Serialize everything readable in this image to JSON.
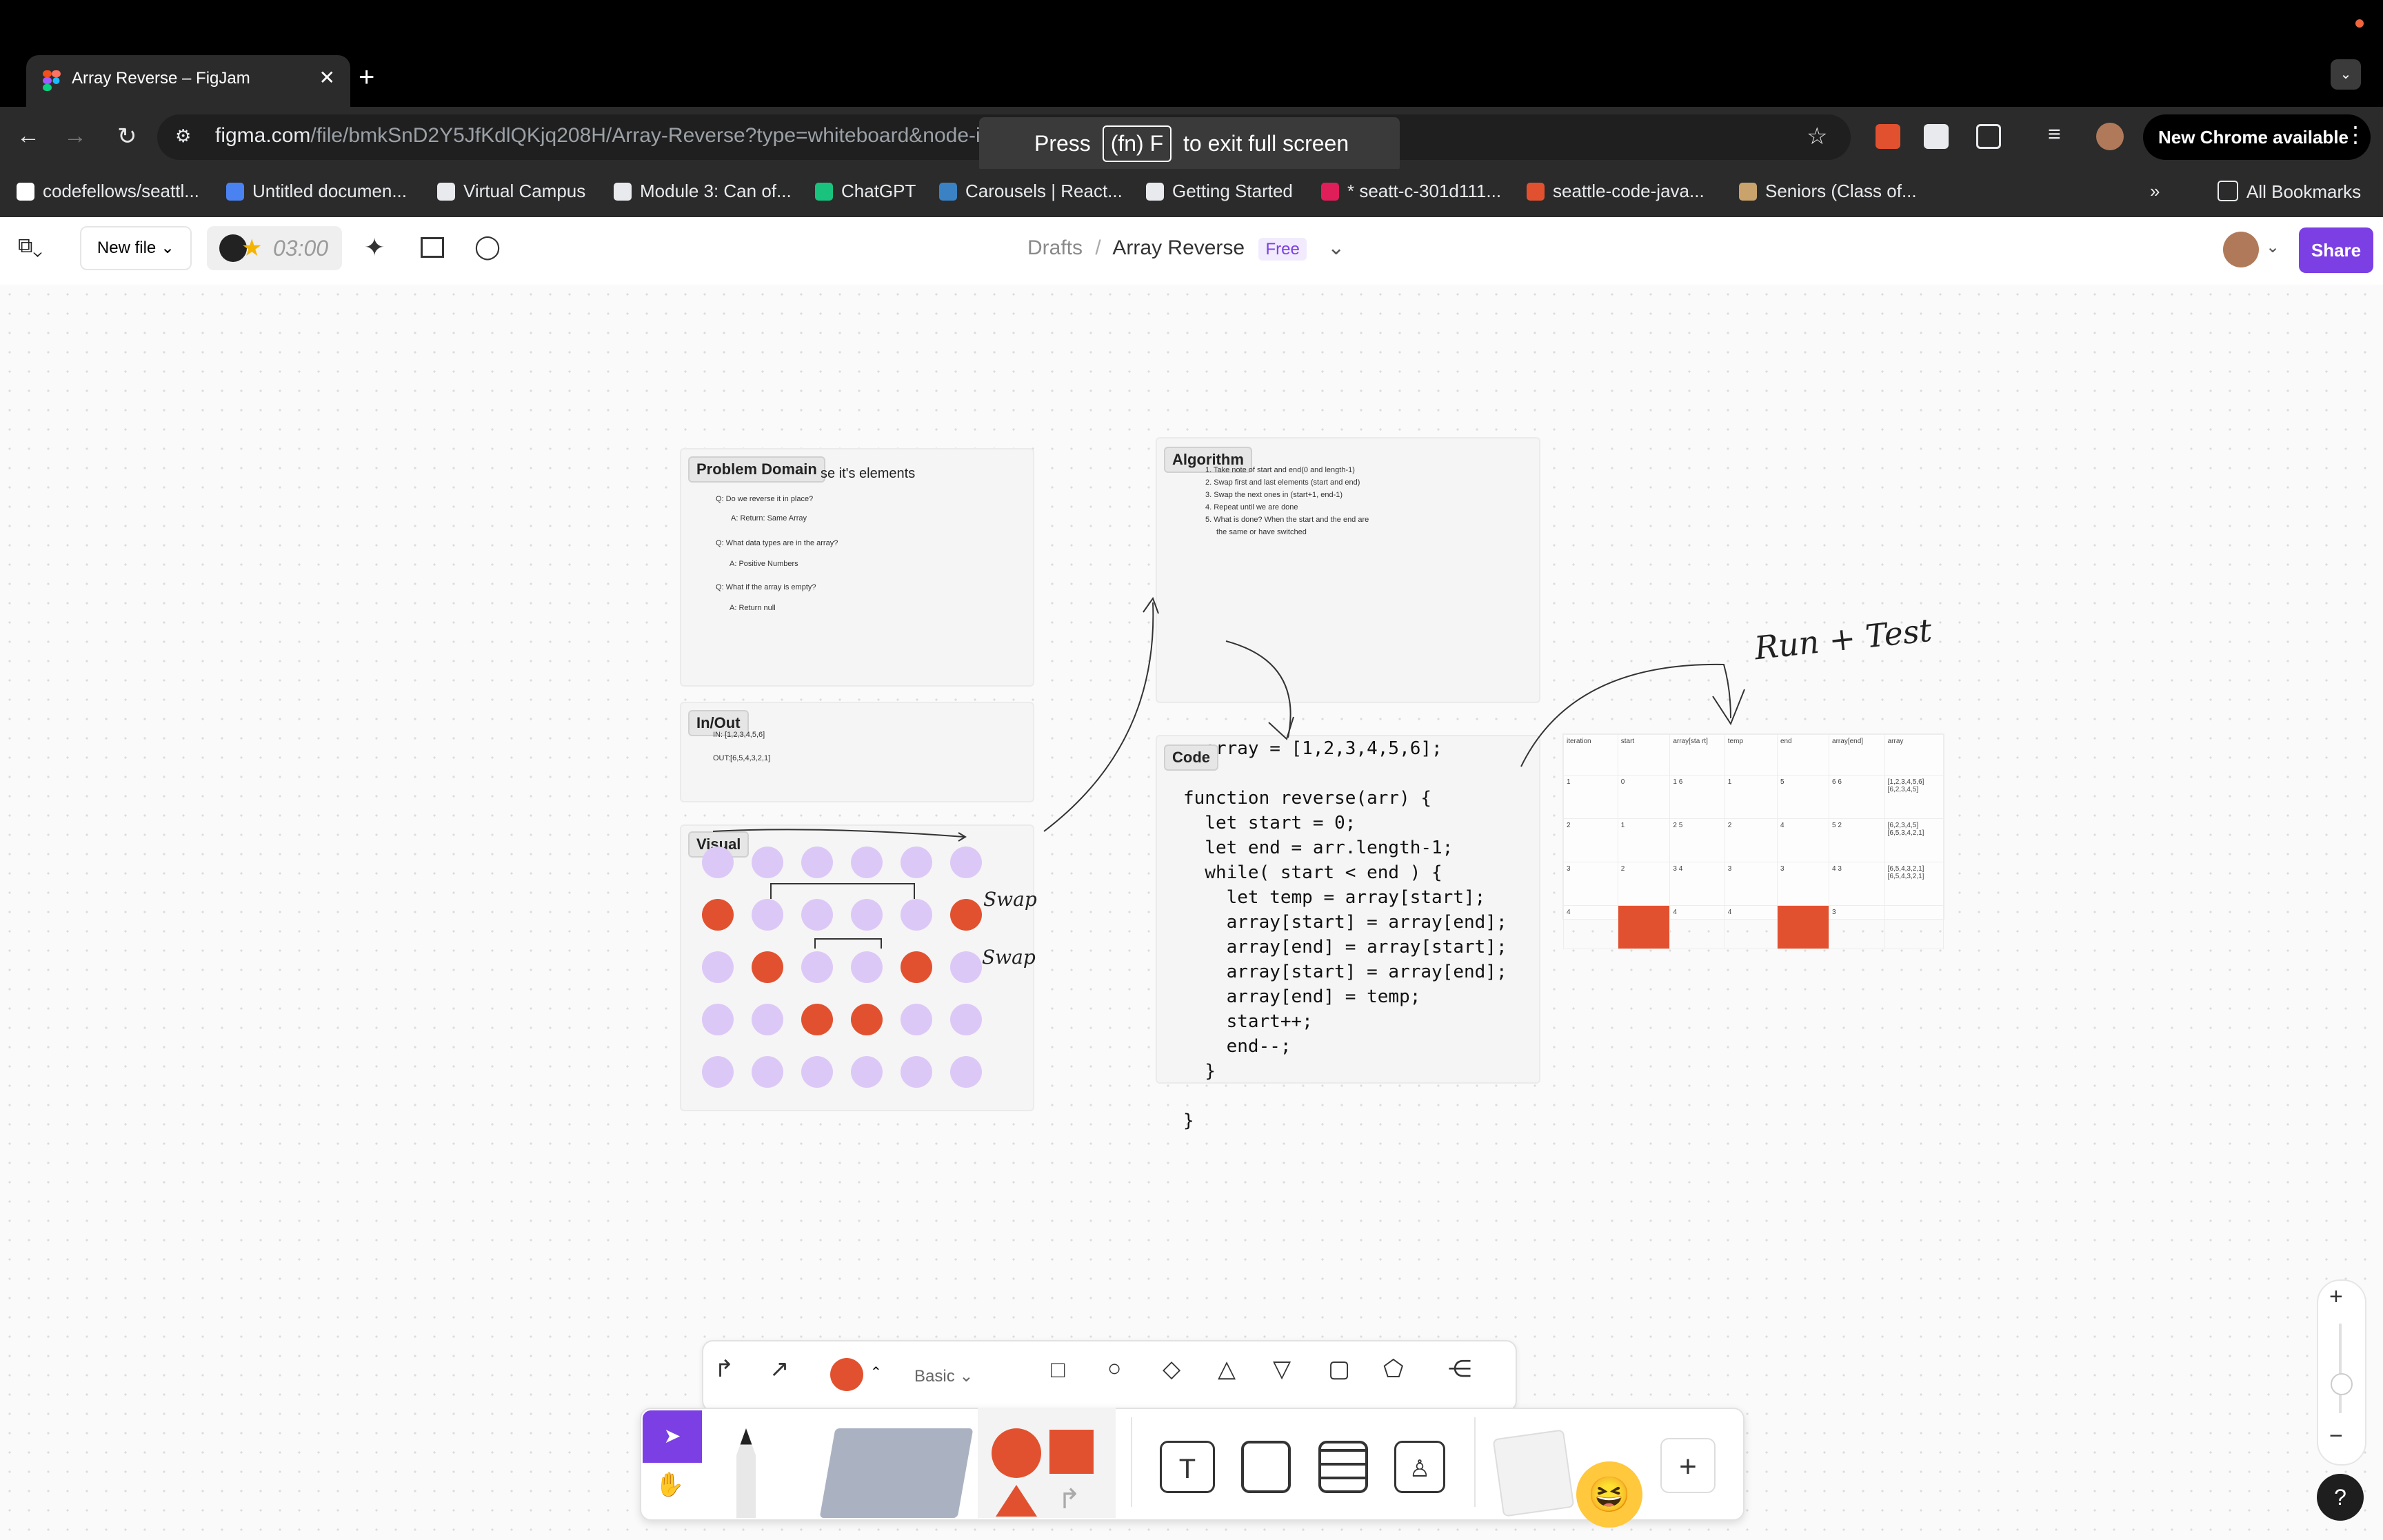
{
  "browser": {
    "tab_title": "Array Reverse – FigJam",
    "tab_close": "✕",
    "new_tab": "+",
    "url_host": "figma.com",
    "url_path": "/file/bmkSnD2Y5JfKdlQKjq208H/Array-Reverse?type=whiteboard&node-id=0-",
    "fullscreen_hint": {
      "press": "Press",
      "key": "(fn) F",
      "rest": "to exit full screen"
    },
    "chrome_available": "New Chrome available",
    "bookmarks": [
      {
        "label": "codefellows/seattl...",
        "color": "#ffffff"
      },
      {
        "label": "Untitled documen...",
        "color": "#4a83f1"
      },
      {
        "label": "Virtual Campus",
        "color": "#e8eaed"
      },
      {
        "label": "Module 3: Can of...",
        "color": "#e8eaed"
      },
      {
        "label": "ChatGPT",
        "color": "#19c37d"
      },
      {
        "label": "Carousels | React...",
        "color": "#3b82c4"
      },
      {
        "label": "Getting Started",
        "color": "#e8eaed"
      },
      {
        "label": "* seatt-c-301d111...",
        "color": "#e01e5a"
      },
      {
        "label": "seattle-code-java...",
        "color": "#e2512f"
      },
      {
        "label": "Seniors (Class of...",
        "color": "#c9a36b"
      }
    ],
    "all_bookmarks": "All Bookmarks",
    "more_bookmarks": "»"
  },
  "figjam": {
    "new_file": "New file ⌄",
    "timer": "03:00",
    "breadcrumb": {
      "drafts": "Drafts",
      "sep": "/",
      "file": "Array Reverse",
      "plan": "Free",
      "chevron": "⌄"
    },
    "share": "Share"
  },
  "board": {
    "problem_domain": {
      "label": "Problem Domain",
      "heading": "se it's elements",
      "lines": [
        "Q: Do we reverse it in place?",
        "A: Return: Same Array",
        "Q: What data types are in the array?",
        "A: Positive Numbers",
        "Q: What if the array is empty?",
        "A: Return null"
      ]
    },
    "in_out": {
      "label": "In/Out",
      "lines": [
        "IN: [1,2,3,4,5,6]",
        "OUT:[6,5,4,3,2,1]"
      ]
    },
    "visual": {
      "label": "Visual",
      "swap1": "Swap",
      "swap2": "Swap"
    },
    "algorithm": {
      "label": "Algorithm",
      "lines": [
        "1. Take note of start and end(0 and length-1)",
        "2. Swap first and last elements (start and end)",
        "3. Swap the next ones in (start+1, end-1)",
        "4. Repeat until we are done",
        "5. What is done? When the start and the end are",
        "the same or have  switched"
      ]
    },
    "code": {
      "label": "Code",
      "lines": [
        "  array = [1,2,3,4,5,6];",
        "",
        "function reverse(arr) {",
        "  let start = 0;",
        "  let end = arr.length-1;",
        "  while( start < end ) {",
        "    let temp = array[start];",
        "    array[start] = array[end];",
        "    array[end] = array[start];",
        "    array[start] = array[end];",
        "    array[end] = temp;",
        "    start++;",
        "    end--;",
        "  }",
        "",
        "}"
      ]
    },
    "run_test": "Run + Test",
    "table": {
      "headers": [
        "iteration",
        "start",
        "array[sta rt]",
        "temp",
        "end",
        "array[end]",
        "array"
      ],
      "rows": [
        [
          "1",
          "0",
          "1 6",
          "1",
          "5",
          "6 6",
          "[1,2,3,4,5,6] [6,2,3,4,5]"
        ],
        [
          "2",
          "1",
          "2 5",
          "2",
          "4",
          "5 2",
          "[6,2,3,4,5] [6,5,3,4,2,1]"
        ],
        [
          "3",
          "2",
          "3 4",
          "3",
          "3",
          "4 3",
          "[6,5,4,3,2,1] [6,5,4,3,2,1]"
        ],
        [
          "4",
          "3",
          "4",
          "4",
          "2",
          "3",
          ""
        ]
      ]
    }
  },
  "bottom": {
    "style": "Basic",
    "accent": "#e2512f",
    "purple": "#7b3fe4"
  },
  "zoom": {
    "plus": "+",
    "minus": "−"
  },
  "help": "?"
}
